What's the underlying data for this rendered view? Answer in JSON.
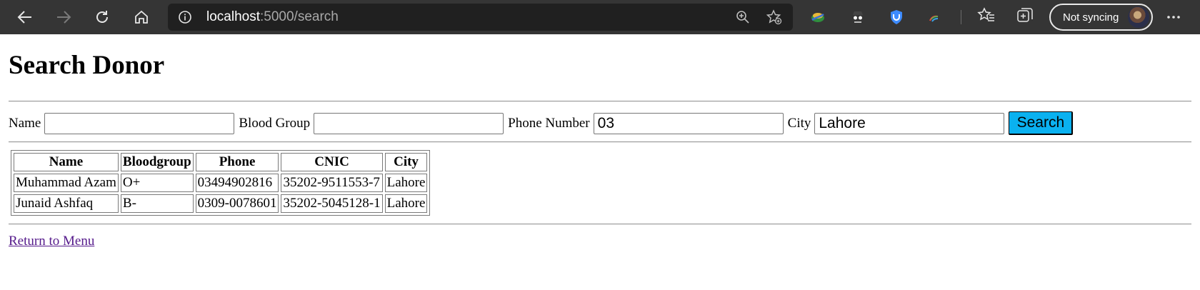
{
  "browser": {
    "url_host": "localhost",
    "url_path": ":5000/search",
    "profile_label": "Not syncing",
    "icons": [
      "back-icon",
      "forward-icon",
      "reload-icon",
      "home-icon",
      "info-icon",
      "zoom-icon",
      "add-favorite-icon",
      "extension-icons",
      "favorites-icon",
      "collections-icon",
      "more-icon"
    ]
  },
  "page": {
    "title": "Search Donor",
    "form": {
      "name_label": "Name",
      "name_value": "",
      "blood_label": "Blood Group",
      "blood_value": "",
      "phone_label": "Phone Number",
      "phone_value": "03",
      "city_label": "City",
      "city_value": "Lahore",
      "search_label": "Search"
    },
    "table": {
      "headers": [
        "Name",
        "Bloodgroup",
        "Phone",
        "CNIC",
        "City"
      ],
      "rows": [
        [
          "Muhammad Azam",
          "O+",
          "03494902816",
          "35202-9511553-7",
          "Lahore"
        ],
        [
          "Junaid Ashfaq",
          "B-",
          "0309-0078601",
          "35202-5045128-1",
          "Lahore"
        ]
      ]
    },
    "return_link": "Return to Menu"
  },
  "colors": {
    "chrome_bg": "#353535",
    "address_bg": "#202020",
    "search_button": "#0ab1f0",
    "visited_link": "#551a8b"
  }
}
